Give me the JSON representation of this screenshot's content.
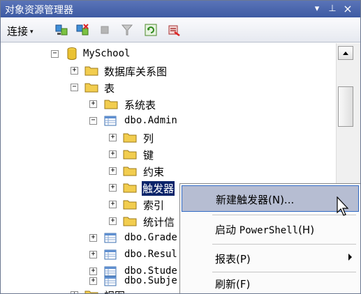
{
  "window": {
    "title": "对象资源管理器",
    "pin_glyph": "▾",
    "autohide_glyph": "⊥",
    "close_glyph": "×"
  },
  "toolbar": {
    "connect_label": "连接",
    "connect_caret": "▾",
    "tools": [
      "connect-object-explorer-icon",
      "disconnect-icon",
      "stop-icon",
      "filter-icon",
      "refresh-icon",
      "sync-icon"
    ]
  },
  "tree": {
    "myschool": "MySchool",
    "db_diagrams": "数据库关系图",
    "tables": "表",
    "system_tables": "系统表",
    "dbo_admin": "dbo.Admin",
    "columns": "列",
    "keys": "键",
    "constraints": "约束",
    "triggers": "触发器",
    "indexes": "索引",
    "statistics": "统计信",
    "dbo_grade": "dbo.Grade",
    "dbo_result": "dbo.Resul",
    "dbo_student": "dbo.Stude",
    "dbo_subject": "dbo.Subje",
    "views": "视图",
    "expand_glyph": "+",
    "collapse_glyph": "−"
  },
  "context_menu": {
    "new_trigger": "新建触发器(N)...",
    "powershell_prefix": "启动 ",
    "powershell_name": "PowerShell",
    "powershell_suffix": "(H)",
    "reports": "报表(P)",
    "refresh": "刷新(F)"
  },
  "colors": {
    "title_bg": "#3d5aa3",
    "selection_bg": "#0a246a",
    "menu_hover": "#b6bdd2"
  }
}
